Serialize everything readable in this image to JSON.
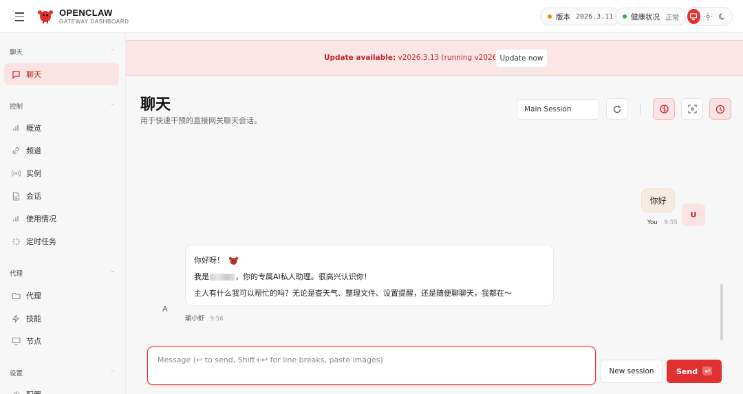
{
  "header": {
    "brand_title": "OPENCLAW",
    "brand_subtitle": "GATEWAY DASHBOARD",
    "version_label": "版本",
    "version_value": "2026.3.11",
    "health_label": "健康状况",
    "health_value": "正常",
    "colors": {
      "accent": "#e03131",
      "version_dot": "#f08c00",
      "health_dot": "#2fb344"
    }
  },
  "sidebar": {
    "sections": [
      {
        "title": "聊天",
        "items": [
          {
            "label": "聊天",
            "icon": "message-square-icon",
            "active": true
          }
        ]
      },
      {
        "title": "控制",
        "items": [
          {
            "label": "概览",
            "icon": "bar-chart-icon"
          },
          {
            "label": "频道",
            "icon": "link-icon"
          },
          {
            "label": "实例",
            "icon": "radio-icon"
          },
          {
            "label": "会话",
            "icon": "file-text-icon"
          },
          {
            "label": "使用情况",
            "icon": "bar-chart-icon"
          },
          {
            "label": "定时任务",
            "icon": "loader-icon"
          }
        ]
      },
      {
        "title": "代理",
        "items": [
          {
            "label": "代理",
            "icon": "folder-icon"
          },
          {
            "label": "技能",
            "icon": "zap-icon"
          },
          {
            "label": "节点",
            "icon": "monitor-icon"
          }
        ]
      },
      {
        "title": "设置",
        "items": [
          {
            "label": "配置",
            "icon": "gear-icon"
          }
        ]
      }
    ]
  },
  "banner": {
    "prefix": "Update available:",
    "text": " v2026.3.13 (running v2026.3.11).",
    "button": "Update now"
  },
  "page": {
    "title": "聊天",
    "subtitle": "用于快速干预的直接网关聊天会话。",
    "session_select": "Main Session"
  },
  "messages": [
    {
      "role": "user",
      "text": "你好",
      "sender": "You",
      "time": "9:55",
      "avatar": "U"
    },
    {
      "role": "assistant",
      "avatar": "A",
      "sender": "瑜小虾",
      "time": "9:56",
      "lines": [
        {
          "text": "你好呀！",
          "icon": "lobster-emoji-icon"
        },
        {
          "prefix": "我是",
          "suffix": "，你的专属AI私人助理。很高兴认识你！"
        },
        {
          "text": "主人有什么我可以帮忙的吗？无论是查天气、整理文件、设置提醒，还是随便聊聊天，我都在～"
        }
      ]
    }
  ],
  "composer": {
    "placeholder": "Message (↩ to send, Shift+↩ for line breaks, paste images)",
    "new_session": "New session",
    "send": "Send"
  }
}
